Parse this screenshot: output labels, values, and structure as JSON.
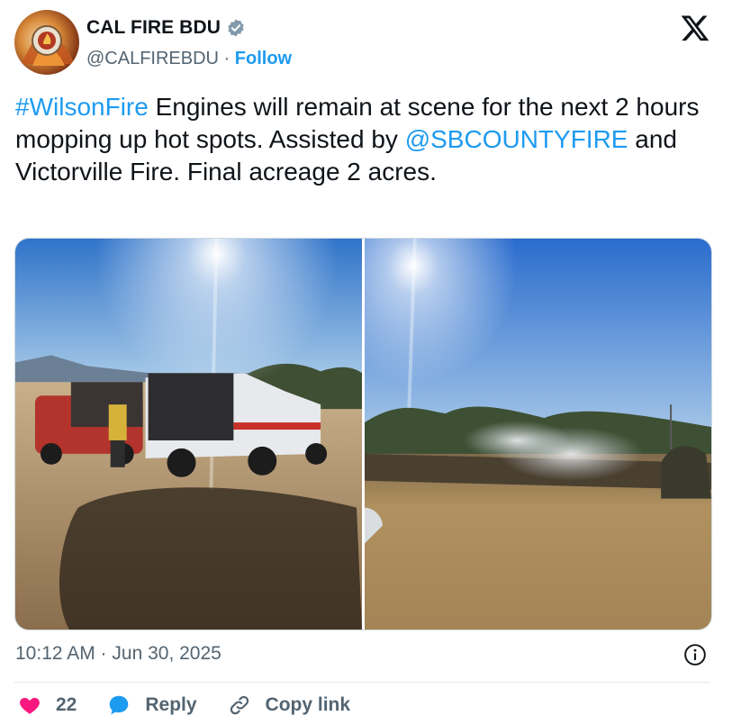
{
  "author": {
    "display_name": "CAL FIRE BDU",
    "handle": "@CALFIREBDU",
    "separator": " · ",
    "follow_label": "Follow"
  },
  "tweet": {
    "hashtag": "#WilsonFire",
    "text_part1": " Engines will remain at scene for the next 2 hours mopping up hot spots. Assisted by ",
    "mention": "@SBCOUNTYFIRE",
    "text_part2": " and Victorville Fire. Final acreage 2 acres."
  },
  "media": {
    "photos": [
      {
        "icon": "photo-fire-engines"
      },
      {
        "icon": "photo-burned-field"
      }
    ]
  },
  "footer": {
    "timestamp": "10:12 AM · Jun 30, 2025"
  },
  "actions": {
    "like_count": "22",
    "reply_label": "Reply",
    "copy_link_label": "Copy link"
  },
  "colors": {
    "link": "#1d9bf0",
    "like": "#f91880",
    "reply": "#1d9bf0",
    "muted": "#536471"
  }
}
